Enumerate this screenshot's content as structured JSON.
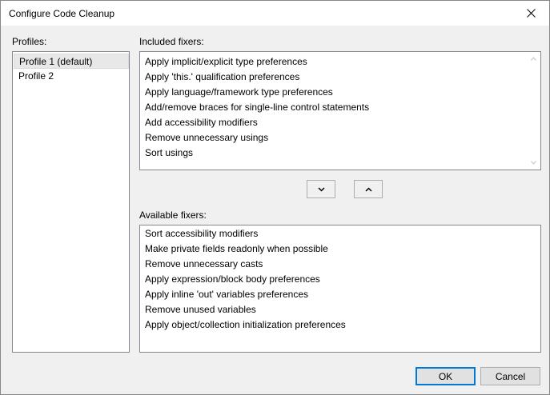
{
  "window": {
    "title": "Configure Code Cleanup"
  },
  "profiles": {
    "label": "Profiles:",
    "items": [
      {
        "label": "Profile 1 (default)",
        "selected": true
      },
      {
        "label": "Profile 2",
        "selected": false
      }
    ]
  },
  "included": {
    "label": "Included fixers:",
    "items": [
      "Apply implicit/explicit type preferences",
      "Apply 'this.' qualification preferences",
      "Apply language/framework type preferences",
      "Add/remove braces for single-line control statements",
      "Add accessibility modifiers",
      "Remove unnecessary usings",
      "Sort usings"
    ]
  },
  "available": {
    "label": "Available fixers:",
    "items": [
      "Sort accessibility modifiers",
      "Make private fields readonly when possible",
      "Remove unnecessary casts",
      "Apply expression/block body preferences",
      "Apply inline 'out' variables preferences",
      "Remove unused variables",
      "Apply object/collection initialization preferences"
    ]
  },
  "buttons": {
    "ok": "OK",
    "cancel": "Cancel"
  },
  "icons": {
    "close": "close-icon",
    "move_down": "chevron-down-icon",
    "move_up": "chevron-up-icon",
    "scroll_up": "scroll-up-arrow-icon",
    "scroll_down": "scroll-down-arrow-icon"
  },
  "colors": {
    "dialog_bg": "#f0f0f0",
    "list_bg": "#ffffff",
    "selection_bg": "#e8e8e8",
    "default_button_border": "#0078d7"
  }
}
